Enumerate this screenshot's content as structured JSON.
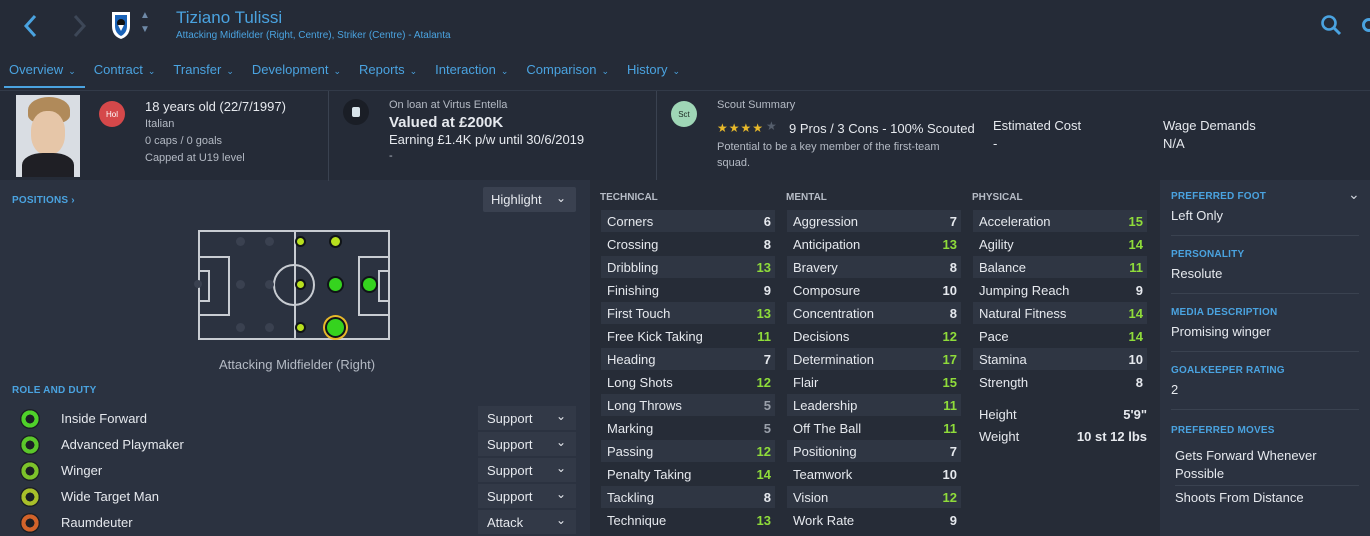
{
  "header": {
    "player_name": "Tiziano Tulissi",
    "subtitle": "Attacking Midfielder (Right, Centre), Striker (Centre) - Atalanta",
    "tabs": [
      {
        "label": "Overview"
      },
      {
        "label": "Contract"
      },
      {
        "label": "Transfer"
      },
      {
        "label": "Development"
      },
      {
        "label": "Reports"
      },
      {
        "label": "Interaction"
      },
      {
        "label": "Comparison"
      },
      {
        "label": "History"
      }
    ]
  },
  "info": {
    "nationality_badge": "Hol",
    "age": "18 years old (22/7/1997)",
    "nationality": "Italian",
    "caps": "0 caps / 0 goals",
    "capped": "Capped at U19 level",
    "loan": "On loan at Virtus Entella",
    "value": "Valued at £200K",
    "earning": "Earning £1.4K p/w until 30/6/2019",
    "dash": "-",
    "scout_badge": "Sct",
    "scout_title": "Scout Summary",
    "scout_stars": "★★★★",
    "scout_summary": "9 Pros / 3 Cons - 100% Scouted",
    "scout_note_1": "Potential to be a key member of the first-team",
    "scout_note_2": "squad.",
    "est_cost_label": "Estimated Cost",
    "est_cost_value": "-",
    "wage_label": "Wage Demands",
    "wage_value": "N/A"
  },
  "positions": {
    "title": "POSITIONS",
    "highlight_label": "Highlight",
    "pitch_caption": "Attacking Midfielder (Right)"
  },
  "roles": {
    "title": "ROLE AND DUTY",
    "items": [
      {
        "name": "Inside Forward",
        "duty": "Support",
        "color": "#4fd12a"
      },
      {
        "name": "Advanced Playmaker",
        "duty": "Support",
        "color": "#5bc72a"
      },
      {
        "name": "Winger",
        "duty": "Support",
        "color": "#7cc22a"
      },
      {
        "name": "Wide Target Man",
        "duty": "Support",
        "color": "#a9bf2a"
      },
      {
        "name": "Raumdeuter",
        "duty": "Attack",
        "color": "#d2632a"
      }
    ]
  },
  "attributes": {
    "technical_title": "TECHNICAL",
    "mental_title": "MENTAL",
    "physical_title": "PHYSICAL",
    "technical": [
      {
        "name": "Corners",
        "value": "6"
      },
      {
        "name": "Crossing",
        "value": "8"
      },
      {
        "name": "Dribbling",
        "value": "13"
      },
      {
        "name": "Finishing",
        "value": "9"
      },
      {
        "name": "First Touch",
        "value": "13"
      },
      {
        "name": "Free Kick Taking",
        "value": "11"
      },
      {
        "name": "Heading",
        "value": "7"
      },
      {
        "name": "Long Shots",
        "value": "12"
      },
      {
        "name": "Long Throws",
        "value": "5"
      },
      {
        "name": "Marking",
        "value": "5"
      },
      {
        "name": "Passing",
        "value": "12"
      },
      {
        "name": "Penalty Taking",
        "value": "14"
      },
      {
        "name": "Tackling",
        "value": "8"
      },
      {
        "name": "Technique",
        "value": "13"
      }
    ],
    "mental": [
      {
        "name": "Aggression",
        "value": "7"
      },
      {
        "name": "Anticipation",
        "value": "13"
      },
      {
        "name": "Bravery",
        "value": "8"
      },
      {
        "name": "Composure",
        "value": "10"
      },
      {
        "name": "Concentration",
        "value": "8"
      },
      {
        "name": "Decisions",
        "value": "12"
      },
      {
        "name": "Determination",
        "value": "17"
      },
      {
        "name": "Flair",
        "value": "15"
      },
      {
        "name": "Leadership",
        "value": "11"
      },
      {
        "name": "Off The Ball",
        "value": "11"
      },
      {
        "name": "Positioning",
        "value": "7"
      },
      {
        "name": "Teamwork",
        "value": "10"
      },
      {
        "name": "Vision",
        "value": "12"
      },
      {
        "name": "Work Rate",
        "value": "9"
      }
    ],
    "physical": [
      {
        "name": "Acceleration",
        "value": "15"
      },
      {
        "name": "Agility",
        "value": "14"
      },
      {
        "name": "Balance",
        "value": "11"
      },
      {
        "name": "Jumping Reach",
        "value": "9"
      },
      {
        "name": "Natural Fitness",
        "value": "14"
      },
      {
        "name": "Pace",
        "value": "14"
      },
      {
        "name": "Stamina",
        "value": "10"
      },
      {
        "name": "Strength",
        "value": "8"
      }
    ],
    "height_label": "Height",
    "height_value": "5'9\"",
    "weight_label": "Weight",
    "weight_value": "10 st 12 lbs"
  },
  "side": {
    "foot_label": "PREFERRED FOOT",
    "foot_value": "Left Only",
    "personality_label": "PERSONALITY",
    "personality_value": "Resolute",
    "media_label": "MEDIA DESCRIPTION",
    "media_value": "Promising winger",
    "gk_label": "GOALKEEPER RATING",
    "gk_value": "2",
    "moves_label": "PREFERRED MOVES",
    "move_1a": "Gets Forward Whenever",
    "move_1b": "Possible",
    "move_2": "Shoots From Distance"
  },
  "colors": {
    "accent": "#4aa3e0",
    "high": "#8fdc3a",
    "mid": "#c9ccd2",
    "low": "#8a9099"
  }
}
